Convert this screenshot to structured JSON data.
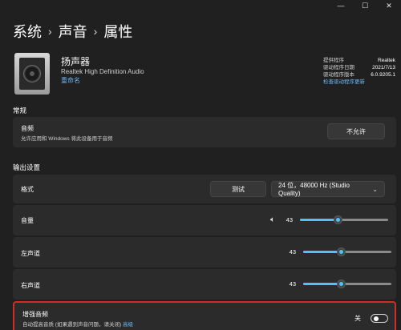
{
  "window": {
    "minimize_glyph": "—",
    "maximize_glyph": "☐",
    "close_glyph": "✕"
  },
  "breadcrumb": {
    "items": [
      "系统",
      "声音",
      "属性"
    ],
    "separator": "›"
  },
  "device": {
    "icon": "speaker-icon",
    "name": "扬声器",
    "subtitle": "Realtek High Definition Audio",
    "rename_link": "重命名"
  },
  "driver": {
    "rows": [
      {
        "label": "提供程序",
        "value": "Realtek"
      },
      {
        "label": "驱动程序日期",
        "value": "2021/7/13"
      },
      {
        "label": "驱动程序版本",
        "value": "6.0.9205.1"
      }
    ],
    "update_link": "检查驱动程序更新"
  },
  "general": {
    "section_title": "常规",
    "audio": {
      "label": "音频",
      "description": "允许应用和 Windows 将此设备用于音频",
      "button": "不允许"
    }
  },
  "output": {
    "section_title": "输出设置",
    "format": {
      "label": "格式",
      "test_button": "测试",
      "selected": "24 位，48000 Hz (Studio Quality)"
    },
    "volume": {
      "label": "音量",
      "value": "43",
      "icon": "speaker-volume-icon"
    },
    "left": {
      "label": "左声道",
      "value": "43"
    },
    "right": {
      "label": "右声道",
      "value": "43"
    },
    "slider_fraction": 0.43,
    "enhance": {
      "label": "增强音频",
      "description": "自动提高音质 (如果遇到声音问题，请关闭)",
      "description_link": "高级",
      "toggle_label": "关",
      "toggle_on": false
    }
  },
  "colors": {
    "accent": "#4cc2ff",
    "link": "#6cb8f6",
    "highlight_border": "#d42a2a"
  }
}
